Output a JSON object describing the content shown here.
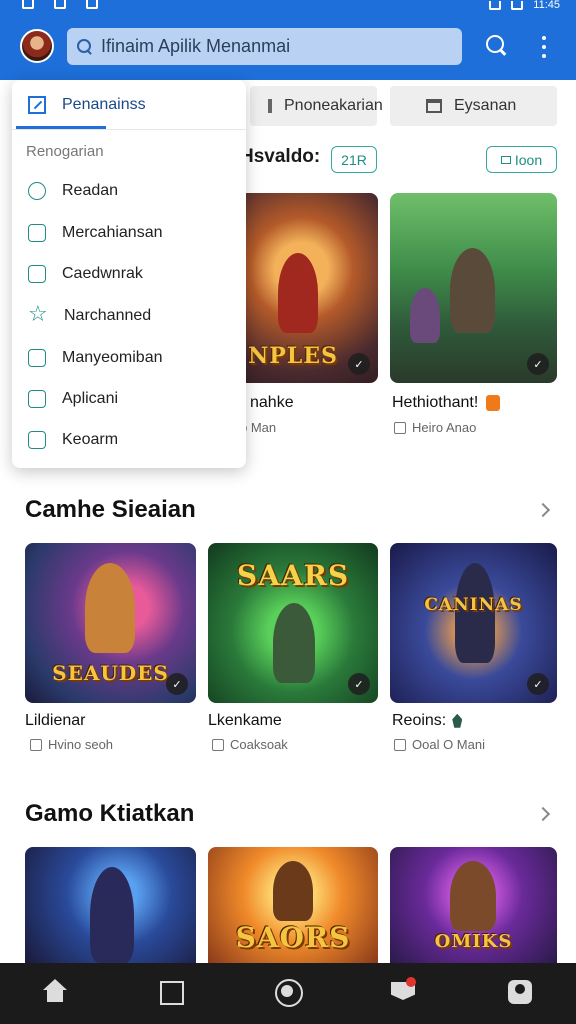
{
  "status_bar": {
    "time": "11:45"
  },
  "search": {
    "placeholder": "Ifinaim Apilik Menanmai"
  },
  "tabs": [
    {
      "label": "Penanainss"
    },
    {
      "label": "Pnoneakarian"
    },
    {
      "label": "Eysanan"
    }
  ],
  "menu": {
    "header": "Penanainss",
    "section_label": "Renogarian",
    "items": [
      {
        "label": "Readan",
        "icon": "clock-icon"
      },
      {
        "label": "Mercahiansan",
        "icon": "edit-icon"
      },
      {
        "label": "Caedwnrak",
        "icon": "note-icon"
      },
      {
        "label": "Narchanned",
        "icon": "star-icon"
      },
      {
        "label": "Manyeomiban",
        "icon": "clipboard-icon"
      },
      {
        "label": "Aplicani",
        "icon": "briefcase-icon"
      },
      {
        "label": "Keoarm",
        "icon": "device-icon"
      }
    ]
  },
  "row1": {
    "heading": "Hsvaldo:",
    "count_chip": "21R",
    "filter_chip": "Ioon",
    "cards": [
      {
        "logo": "NPLES",
        "title": "nahke",
        "sub": "b Man"
      },
      {
        "logo": "",
        "title": "Hethiothant!",
        "sub": "Heiro Anao"
      }
    ]
  },
  "section2": {
    "title": "Camhe Sieaian",
    "cards": [
      {
        "logo": "SEAUDES",
        "title": "Lildienar",
        "sub": "Hvino seoh"
      },
      {
        "logo": "SAARS",
        "title": "Lkenkame",
        "sub": "Coaksoak"
      },
      {
        "logo": "CANINAS",
        "title": "Reoins:",
        "sub": "Ooal O Mani"
      }
    ]
  },
  "section3": {
    "title": "Gamo Ktiatkan",
    "cards": [
      {
        "logo": ""
      },
      {
        "logo": "SAORS"
      },
      {
        "logo": "OMIKS"
      }
    ]
  },
  "colors": {
    "primary": "#1e6fd9",
    "accent_teal": "#1f8d84",
    "nav_background": "#1b1b1b",
    "badge_red": "#e0342e"
  }
}
